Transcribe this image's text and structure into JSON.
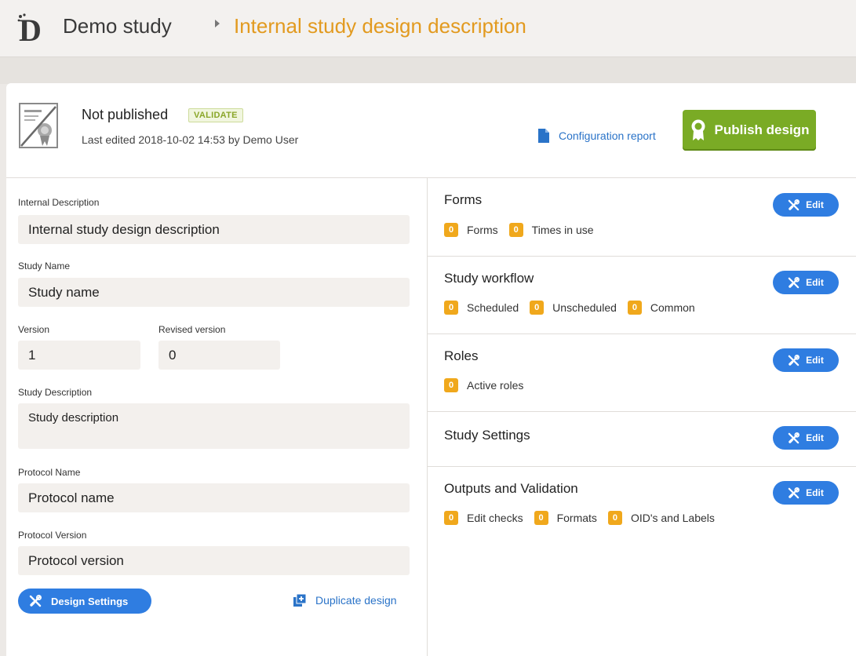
{
  "header": {
    "logo_letter": "D",
    "breadcrumb_home": "Demo study",
    "breadcrumb_current": "Internal study design description"
  },
  "status": {
    "title": "Not published",
    "validate_label": "VALIDATE",
    "last_edited": "Last edited 2018-10-02 14:53 by Demo User",
    "config_report_label": "Configuration report",
    "publish_label": "Publish design"
  },
  "fields": {
    "internal_description": {
      "label": "Internal Description",
      "value": "Internal study design description"
    },
    "study_name": {
      "label": "Study Name",
      "value": "Study name"
    },
    "version": {
      "label": "Version",
      "value": "1"
    },
    "revised_version": {
      "label": "Revised version",
      "value": "0"
    },
    "study_description": {
      "label": "Study Description",
      "value": "Study description"
    },
    "protocol_name": {
      "label": "Protocol Name",
      "value": "Protocol name"
    },
    "protocol_version": {
      "label": "Protocol Version",
      "value": "Protocol version"
    }
  },
  "left_actions": {
    "design_settings_label": "Design Settings",
    "duplicate_label": "Duplicate design"
  },
  "sections": {
    "edit_label": "Edit",
    "forms": {
      "title": "Forms",
      "stats": [
        {
          "count": "0",
          "label": "Forms"
        },
        {
          "count": "0",
          "label": "Times in use"
        }
      ]
    },
    "workflow": {
      "title": "Study workflow",
      "stats": [
        {
          "count": "0",
          "label": "Scheduled"
        },
        {
          "count": "0",
          "label": "Unscheduled"
        },
        {
          "count": "0",
          "label": "Common"
        }
      ]
    },
    "roles": {
      "title": "Roles",
      "stats": [
        {
          "count": "0",
          "label": "Active roles"
        }
      ]
    },
    "settings": {
      "title": "Study Settings"
    },
    "outputs": {
      "title": "Outputs and Validation",
      "stats": [
        {
          "count": "0",
          "label": "Edit checks"
        },
        {
          "count": "0",
          "label": "Formats"
        },
        {
          "count": "0",
          "label": "OID's and Labels"
        }
      ]
    }
  },
  "colors": {
    "accent_orange": "#e29a1f",
    "publish_green": "#7aab25",
    "button_blue": "#2f7de1",
    "count_badge": "#f0a81c"
  }
}
